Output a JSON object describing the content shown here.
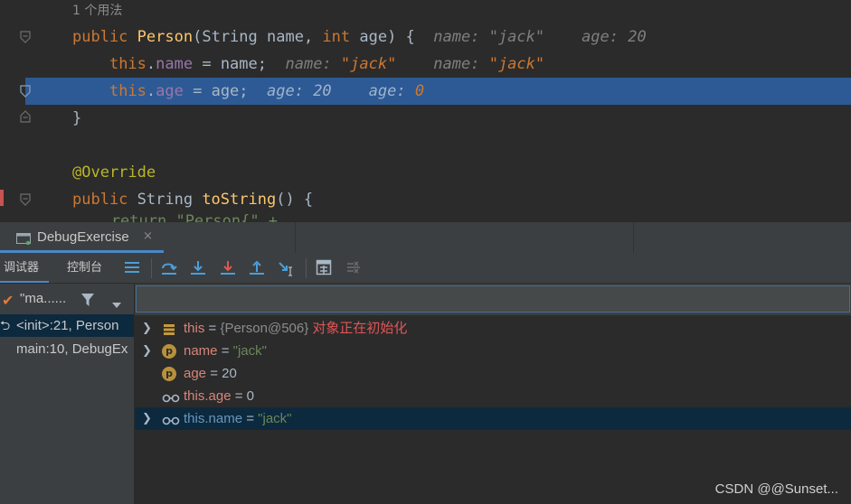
{
  "editor": {
    "usages": "1 个用法",
    "lines": {
      "l1": {
        "kw1": "public",
        "ctor": "Person",
        "open": "(",
        "t1": "String",
        "p1": " name, ",
        "kw2": "int",
        "p2": " age) {",
        "h1": "name: \"jack\"",
        "h2": "age: 20"
      },
      "l2": {
        "this": "this",
        "dot": ".",
        "field": "name",
        "rest": " = name;",
        "h1n": "name: ",
        "h1v": "\"jack\"",
        "h2n": "name: ",
        "h2v": "\"jack\""
      },
      "l3": {
        "this": "this",
        "dot": ".",
        "field": "age",
        "rest": " = age;",
        "h1": "age: 20",
        "h2n": "age: ",
        "h2v": "0"
      },
      "l4": {
        "text": "}"
      },
      "l5": {
        "text": "@Override"
      },
      "l6": {
        "kw1": "public",
        "rest1": " String ",
        "fn": "toString",
        "rest2": "() {"
      },
      "l7": {
        "partial": "            return \"Person{\" +"
      }
    }
  },
  "debug": {
    "session_tab": "DebugExercise",
    "close": "×",
    "subtabs": {
      "debugger": "调试器",
      "console": "控制台"
    },
    "toolbar_icons": [
      "layout-icon",
      "step-over-icon",
      "step-into-icon",
      "force-step-into-icon",
      "step-out-icon",
      "run-to-cursor-icon",
      "evaluate-icon",
      "trace-icon"
    ],
    "thread": {
      "label": "\"ma......"
    },
    "frames": [
      {
        "label": "<init>:21, Person",
        "selected": true
      },
      {
        "label": "main:10, DebugEx",
        "selected": false
      }
    ],
    "eval_placeholder": "",
    "variables": [
      {
        "name": "this",
        "eq": " = ",
        "value": "{Person@506}",
        "note": " 对象正在初始化",
        "icon": "object-field-icon",
        "expandable": true
      },
      {
        "name": "name",
        "eq": " = ",
        "value": "\"jack\"",
        "icon": "parameter-icon",
        "expandable": true
      },
      {
        "name": "age",
        "eq": " = ",
        "value": "20",
        "icon": "parameter-icon",
        "expandable": false
      },
      {
        "name": "this.age",
        "eq": " = ",
        "value": "0",
        "icon": "watch-icon",
        "expandable": false
      },
      {
        "name": "this.name",
        "eq": " = ",
        "value": "\"jack\"",
        "icon": "watch-icon",
        "expandable": true
      }
    ]
  },
  "watermark": "CSDN @@Sunset...",
  "colors": {
    "selection": "#2d5a94",
    "accent": "#4a88c7",
    "keyword": "#cc7832",
    "string": "#6a8759"
  }
}
